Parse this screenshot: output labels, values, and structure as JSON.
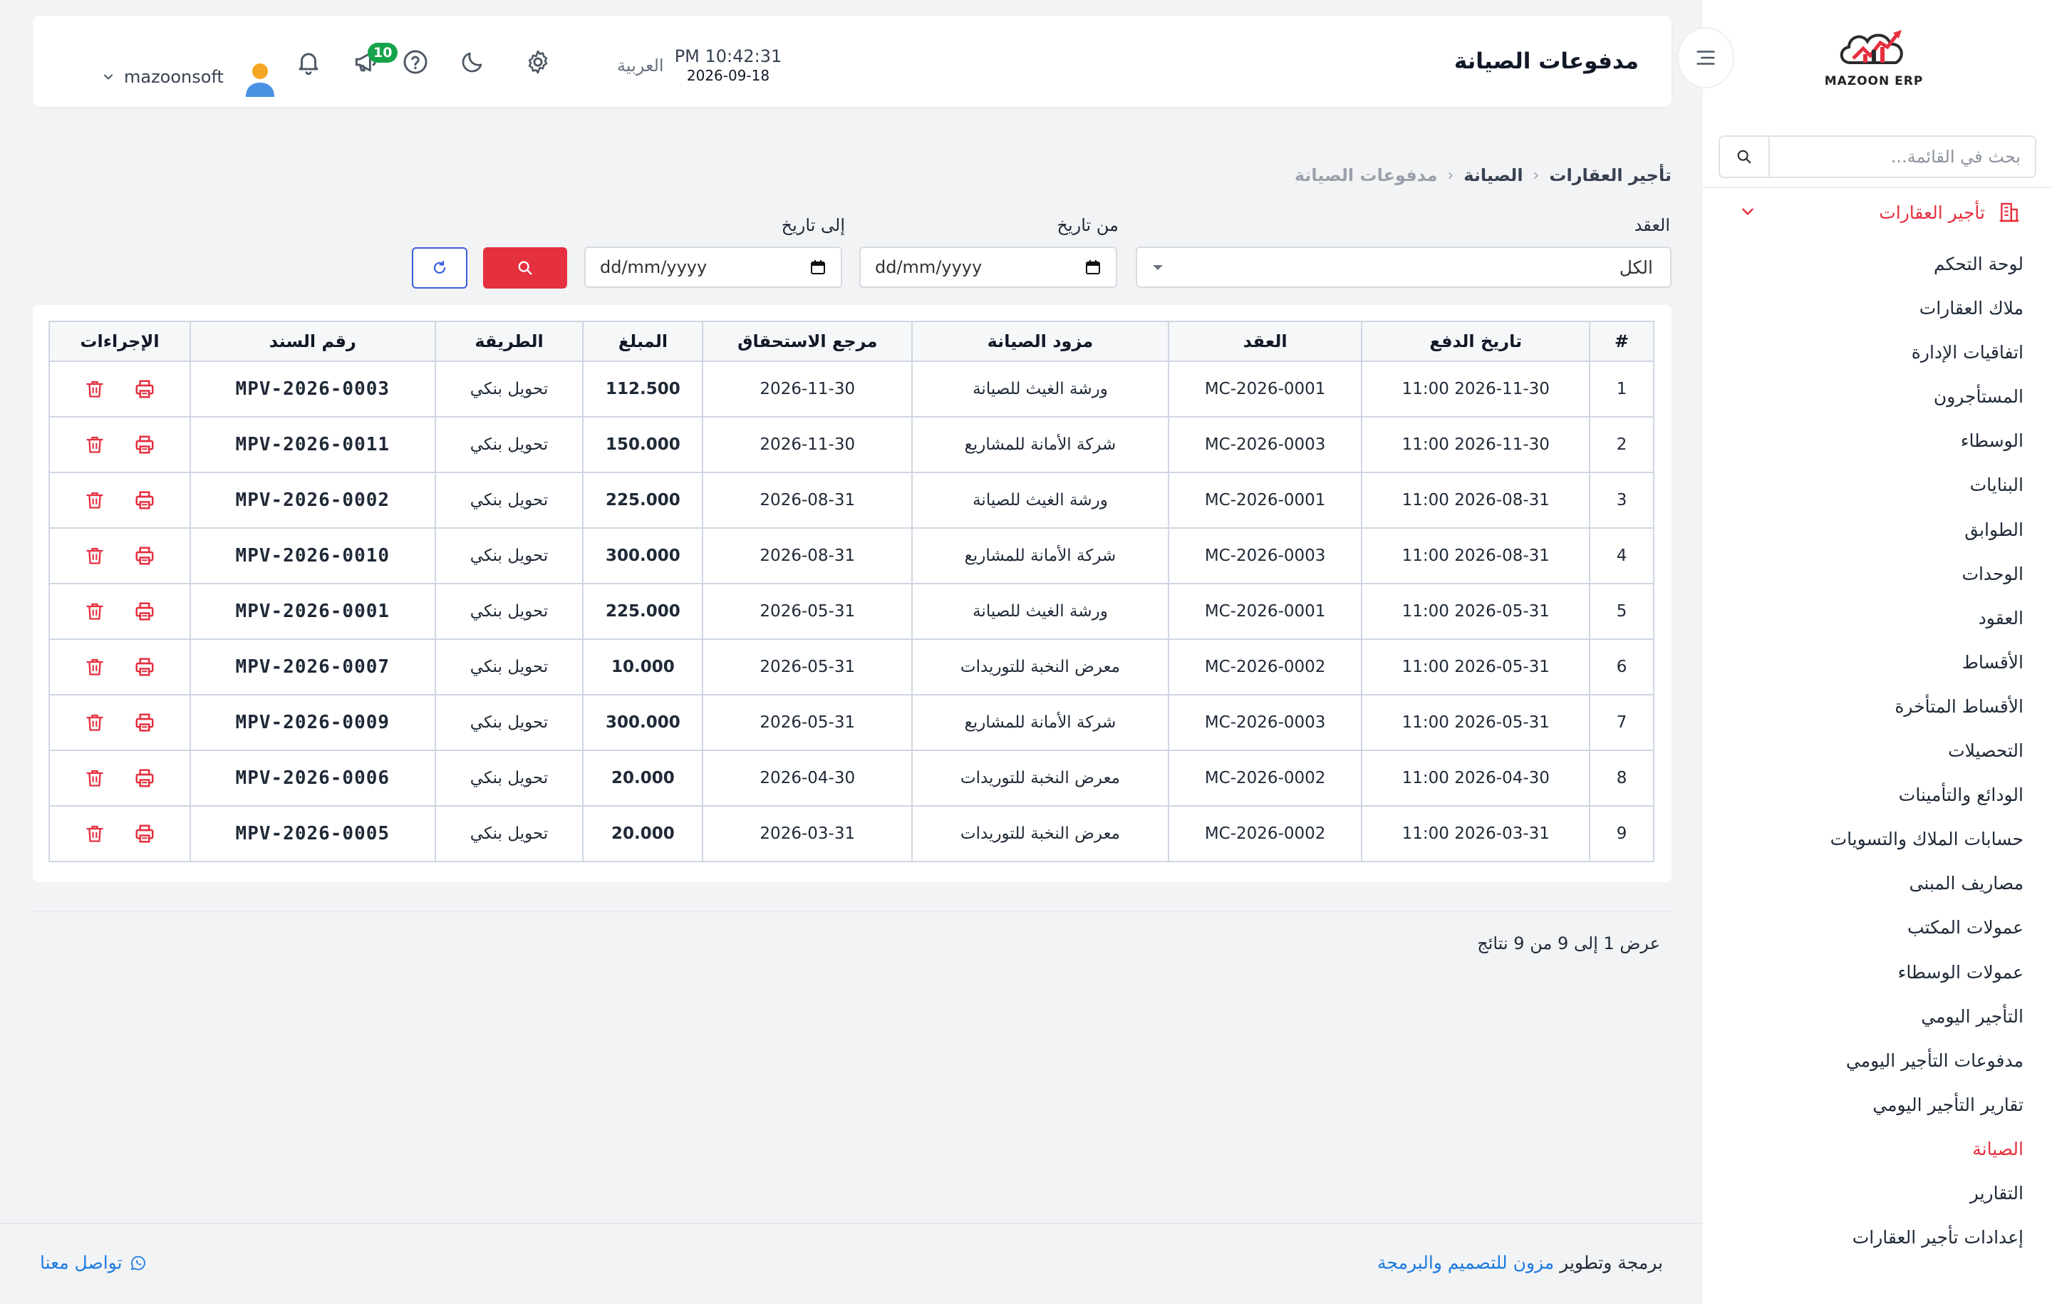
{
  "app": {
    "logo_text": "MAZOON ERP"
  },
  "sidebar": {
    "search_placeholder": "بحث في القائمة...",
    "group_label": "تأجير العقارات",
    "items": [
      {
        "label": "لوحة التحكم"
      },
      {
        "label": "ملاك العقارات"
      },
      {
        "label": "اتفاقيات الإدارة"
      },
      {
        "label": "المستأجرون"
      },
      {
        "label": "الوسطاء"
      },
      {
        "label": "البنايات"
      },
      {
        "label": "الطوابق"
      },
      {
        "label": "الوحدات"
      },
      {
        "label": "العقود"
      },
      {
        "label": "الأقساط"
      },
      {
        "label": "الأقساط المتأخرة"
      },
      {
        "label": "التحصيلات"
      },
      {
        "label": "الودائع والتأمينات"
      },
      {
        "label": "حسابات الملاك والتسويات"
      },
      {
        "label": "مصاريف المبنى"
      },
      {
        "label": "عمولات المكتب"
      },
      {
        "label": "عمولات الوسطاء"
      },
      {
        "label": "التأجير اليومي"
      },
      {
        "label": "مدفوعات التأجير اليومي"
      },
      {
        "label": "تقارير التأجير اليومي"
      },
      {
        "label": "الصيانة",
        "active": true
      },
      {
        "label": "التقارير"
      },
      {
        "label": "إعدادات تأجير العقارات"
      }
    ]
  },
  "header": {
    "title": "مدفوعات الصيانة",
    "time": "PM 10:42:31",
    "date": "2026-09-18",
    "language": "العربية",
    "notification_count": "10",
    "username": "mazoonsoft"
  },
  "breadcrumb": [
    "تأجير العقارات",
    "الصيانة",
    "مدفوعات الصيانة"
  ],
  "filters": {
    "contract_label": "العقد",
    "contract_value": "الكل",
    "from_label": "من تاريخ",
    "from_value": "dd/mm/yyyy",
    "to_label": "إلى تاريخ",
    "to_value": "dd/mm/yyyy"
  },
  "table": {
    "headers": [
      "#",
      "تاريخ الدفع",
      "العقد",
      "مزود الصيانة",
      "مرجع الاستحقاق",
      "المبلغ",
      "الطريقة",
      "رقم السند",
      "الإجراءات"
    ],
    "rows": [
      [
        "1",
        "2026-11-30 11:00",
        "MC-2026-0001",
        "ورشة الغيث للصيانة",
        "2026-11-30",
        "112.500",
        "تحويل بنكي",
        "MPV-2026-0003"
      ],
      [
        "2",
        "2026-11-30 11:00",
        "MC-2026-0003",
        "شركة الأمانة للمشاريع",
        "2026-11-30",
        "150.000",
        "تحويل بنكي",
        "MPV-2026-0011"
      ],
      [
        "3",
        "2026-08-31 11:00",
        "MC-2026-0001",
        "ورشة الغيث للصيانة",
        "2026-08-31",
        "225.000",
        "تحويل بنكي",
        "MPV-2026-0002"
      ],
      [
        "4",
        "2026-08-31 11:00",
        "MC-2026-0003",
        "شركة الأمانة للمشاريع",
        "2026-08-31",
        "300.000",
        "تحويل بنكي",
        "MPV-2026-0010"
      ],
      [
        "5",
        "2026-05-31 11:00",
        "MC-2026-0001",
        "ورشة الغيث للصيانة",
        "2026-05-31",
        "225.000",
        "تحويل بنكي",
        "MPV-2026-0001"
      ],
      [
        "6",
        "2026-05-31 11:00",
        "MC-2026-0002",
        "معرض النخبة للتوريدات",
        "2026-05-31",
        "10.000",
        "تحويل بنكي",
        "MPV-2026-0007"
      ],
      [
        "7",
        "2026-05-31 11:00",
        "MC-2026-0003",
        "شركة الأمانة للمشاريع",
        "2026-05-31",
        "300.000",
        "تحويل بنكي",
        "MPV-2026-0009"
      ],
      [
        "8",
        "2026-04-30 11:00",
        "MC-2026-0002",
        "معرض النخبة للتوريدات",
        "2026-04-30",
        "20.000",
        "تحويل بنكي",
        "MPV-2026-0006"
      ],
      [
        "9",
        "2026-03-31 11:00",
        "MC-2026-0002",
        "معرض النخبة للتوريدات",
        "2026-03-31",
        "20.000",
        "تحويل بنكي",
        "MPV-2026-0005"
      ]
    ]
  },
  "results_text": "عرض 1 إلى 9 من 9 نتائج",
  "footer": {
    "credit_prefix": "برمجة وتطوير",
    "credit_brand": "مزون للتصميم والبرمجة",
    "contact": "تواصل معنا"
  },
  "colors": {
    "accent": "#e5303f",
    "link": "#1e7be0",
    "badge": "#16a34a"
  }
}
